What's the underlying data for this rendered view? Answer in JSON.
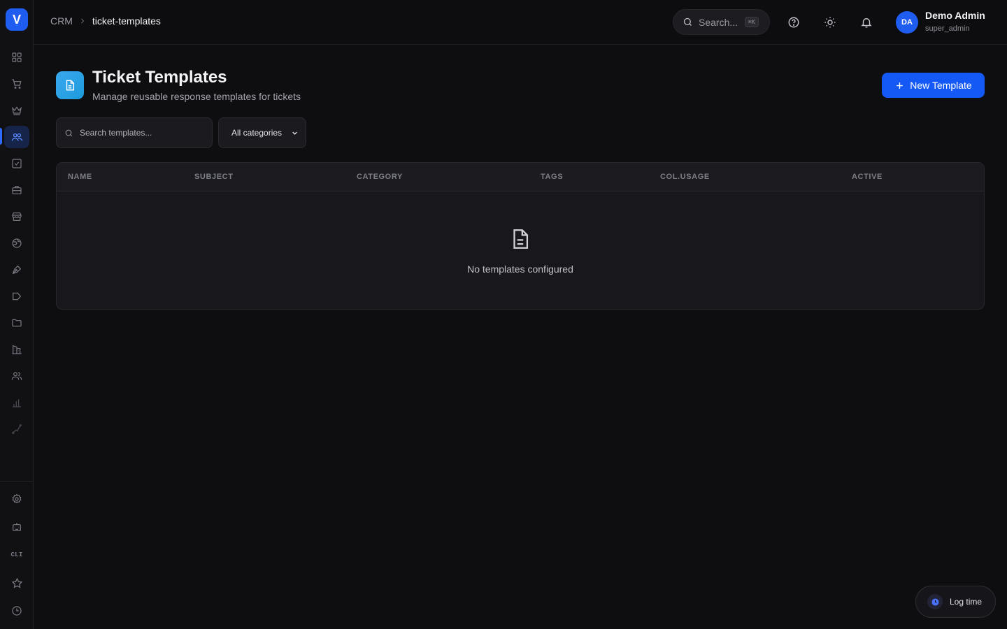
{
  "app": {
    "logo_letter": "V"
  },
  "sidebar": {
    "items": [
      {
        "name": "grid-icon"
      },
      {
        "name": "cart-icon"
      },
      {
        "name": "crown-icon"
      },
      {
        "name": "users-icon",
        "active": true
      },
      {
        "name": "checkbox-icon"
      },
      {
        "name": "briefcase-icon"
      },
      {
        "name": "store-icon"
      },
      {
        "name": "globe-icon"
      },
      {
        "name": "pen-icon"
      },
      {
        "name": "megaphone-icon"
      },
      {
        "name": "folder-icon"
      },
      {
        "name": "building-icon"
      },
      {
        "name": "team-icon"
      },
      {
        "name": "bar-chart-icon"
      },
      {
        "name": "trend-icon"
      }
    ],
    "bottom": {
      "settings_icon": "gear-icon",
      "robot_icon": "robot-icon",
      "cli_label": "CLI",
      "star_icon": "star-icon",
      "clock_icon": "clock-icon"
    }
  },
  "topbar": {
    "breadcrumb": {
      "root": "CRM",
      "current": "ticket-templates"
    },
    "search": {
      "placeholder": "Search...",
      "shortcut": "⌘K"
    },
    "user": {
      "initials": "DA",
      "name": "Demo Admin",
      "role": "super_admin"
    }
  },
  "page": {
    "title": "Ticket Templates",
    "subtitle": "Manage reusable response templates for tickets",
    "new_button_label": "New Template",
    "accent_color": "#1459f5",
    "icon_color": "#2ba3e8"
  },
  "filters": {
    "search_placeholder": "Search templates...",
    "category_selected": "All categories"
  },
  "table": {
    "columns": [
      "NAME",
      "SUBJECT",
      "CATEGORY",
      "TAGS",
      "COL.USAGE",
      "ACTIVE"
    ],
    "rows": [],
    "empty_message": "No templates configured"
  },
  "log_time": {
    "label": "Log time"
  }
}
